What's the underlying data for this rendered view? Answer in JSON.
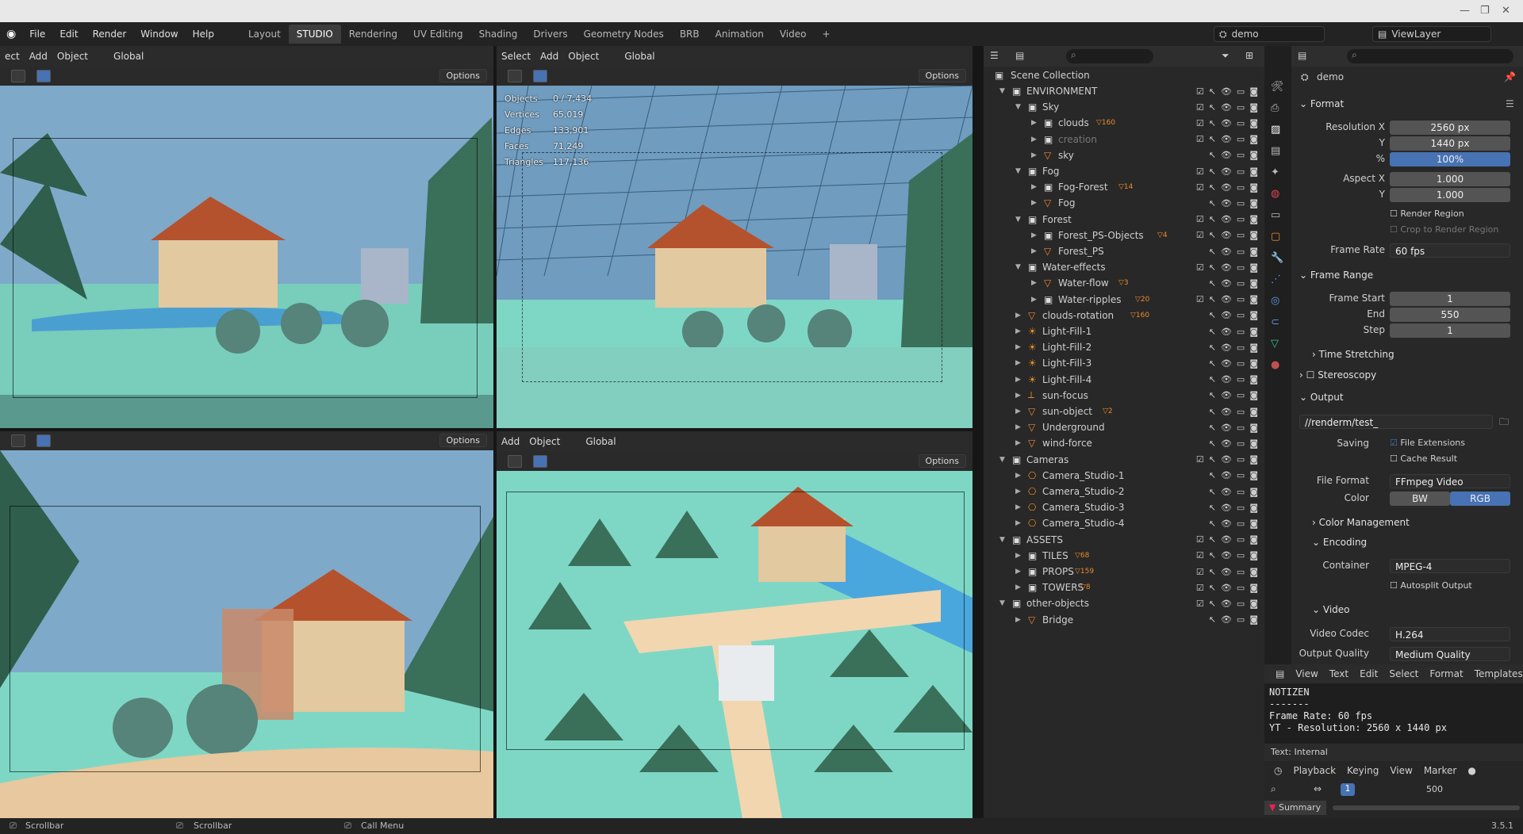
{
  "topbar": {
    "menus": [
      "File",
      "Edit",
      "Render",
      "Window",
      "Help"
    ],
    "workspaces": [
      "Layout",
      "STUDIO",
      "Rendering",
      "UV Editing",
      "Shading",
      "Drivers",
      "Geometry Nodes",
      "BRB",
      "Animation",
      "Video"
    ],
    "active_workspace": "STUDIO",
    "plus": "+",
    "scene_name": "demo",
    "view_layer": "ViewLayer"
  },
  "viewports": {
    "tl": {
      "header": [
        "ect",
        "Add",
        "Object",
        "Global"
      ],
      "options": "Options"
    },
    "tr": {
      "header": [
        "Select",
        "Add",
        "Object",
        "Global"
      ],
      "options": "Options",
      "stats": [
        [
          "Objects",
          "0 / 7,434"
        ],
        [
          "Vertices",
          "65,019"
        ],
        [
          "Edges",
          "133,901"
        ],
        [
          "Faces",
          "71,249"
        ],
        [
          "Triangles",
          "117,136"
        ]
      ]
    },
    "bl": {
      "header": [],
      "options": "Options"
    },
    "br": {
      "header": [
        "Add",
        "Object",
        "Global"
      ],
      "options": "Options"
    }
  },
  "outliner": {
    "root": "Scene Collection",
    "rows": [
      {
        "name": "ENVIRONMENT",
        "indent": 0,
        "type": "collection",
        "expanded": true
      },
      {
        "name": "Sky",
        "indent": 1,
        "type": "collection",
        "expanded": true
      },
      {
        "name": "clouds",
        "indent": 2,
        "type": "collection",
        "badge": "160"
      },
      {
        "name": "creation",
        "indent": 2,
        "type": "collection",
        "dim": true
      },
      {
        "name": "sky",
        "indent": 2,
        "type": "mesh"
      },
      {
        "name": "Fog",
        "indent": 1,
        "type": "collection",
        "expanded": true
      },
      {
        "name": "Fog-Forest",
        "indent": 2,
        "type": "collection",
        "badge": "14"
      },
      {
        "name": "Fog",
        "indent": 2,
        "type": "mesh"
      },
      {
        "name": "Forest",
        "indent": 1,
        "type": "collection",
        "expanded": true
      },
      {
        "name": "Forest_PS-Objects",
        "indent": 2,
        "type": "collection",
        "badge": "4"
      },
      {
        "name": "Forest_PS",
        "indent": 2,
        "type": "mesh"
      },
      {
        "name": "Water-effects",
        "indent": 1,
        "type": "collection",
        "expanded": true
      },
      {
        "name": "Water-flow",
        "indent": 2,
        "type": "mesh",
        "badge": "3"
      },
      {
        "name": "Water-ripples",
        "indent": 2,
        "type": "collection",
        "badge": "20"
      },
      {
        "name": "clouds-rotation",
        "indent": 1,
        "type": "mesh",
        "badge": "160"
      },
      {
        "name": "Light-Fill-1",
        "indent": 1,
        "type": "light"
      },
      {
        "name": "Light-Fill-2",
        "indent": 1,
        "type": "light"
      },
      {
        "name": "Light-Fill-3",
        "indent": 1,
        "type": "light"
      },
      {
        "name": "Light-Fill-4",
        "indent": 1,
        "type": "light"
      },
      {
        "name": "sun-focus",
        "indent": 1,
        "type": "empty"
      },
      {
        "name": "sun-object",
        "indent": 1,
        "type": "mesh",
        "badge": "2"
      },
      {
        "name": "Underground",
        "indent": 1,
        "type": "mesh"
      },
      {
        "name": "wind-force",
        "indent": 1,
        "type": "mesh"
      },
      {
        "name": "Cameras",
        "indent": 0,
        "type": "collection",
        "expanded": true
      },
      {
        "name": "Camera_Studio-1",
        "indent": 1,
        "type": "camera"
      },
      {
        "name": "Camera_Studio-2",
        "indent": 1,
        "type": "camera"
      },
      {
        "name": "Camera_Studio-3",
        "indent": 1,
        "type": "camera"
      },
      {
        "name": "Camera_Studio-4",
        "indent": 1,
        "type": "camera"
      },
      {
        "name": "ASSETS",
        "indent": 0,
        "type": "collection",
        "expanded": true
      },
      {
        "name": "TILES",
        "indent": 1,
        "type": "collection",
        "badge": "68"
      },
      {
        "name": "PROPS",
        "indent": 1,
        "type": "collection",
        "badge": "159"
      },
      {
        "name": "TOWERS",
        "indent": 1,
        "type": "collection",
        "badge": "8"
      },
      {
        "name": "other-objects",
        "indent": 0,
        "type": "collection",
        "expanded": true
      },
      {
        "name": "Bridge",
        "indent": 1,
        "type": "mesh"
      }
    ]
  },
  "props": {
    "object": "demo",
    "format": "Format",
    "res_x_label": "Resolution X",
    "res_x": "2560 px",
    "y_label": "Y",
    "res_y": "1440 px",
    "pct_label": "%",
    "pct": "100%",
    "aspect_label": "Aspect X",
    "aspect_x": "1.000",
    "aspect_y": "1.000",
    "render_region": "Render Region",
    "crop": "Crop to Render Region",
    "frame_rate_label": "Frame Rate",
    "frame_rate": "60 fps",
    "frame_range": "Frame Range",
    "start_label": "Frame Start",
    "start": "1",
    "end_label": "End",
    "end": "550",
    "step_label": "Step",
    "step": "1",
    "time_stretching": "Time Stretching",
    "stereoscopy": "Stereoscopy",
    "output": "Output",
    "path": "//renderm/test_",
    "saving_label": "Saving",
    "file_ext": "File Extensions",
    "cache": "Cache Result",
    "file_format_label": "File Format",
    "file_format": "FFmpeg Video",
    "color_label": "Color",
    "bw": "BW",
    "rgb": "RGB",
    "color_mgmt": "Color Management",
    "encoding": "Encoding",
    "container_label": "Container",
    "container": "MPEG-4",
    "autosplit": "Autosplit Output",
    "video": "Video",
    "codec_label": "Video Codec",
    "codec": "H.264",
    "quality_label": "Output Quality",
    "quality": "Medium Quality"
  },
  "text_editor": {
    "menus": [
      "View",
      "Text",
      "Edit",
      "Select",
      "Format",
      "Templates"
    ],
    "lines": [
      "NOTIZEN",
      "-------",
      "Frame Rate: 60 fps",
      "YT - Resolution: 2560 x 1440 px"
    ],
    "footer": "Text: Internal"
  },
  "timeline": {
    "menus": [
      "Playback",
      "Keying",
      "View",
      "Marker"
    ],
    "current": "1",
    "mark": "500",
    "summary": "Summary"
  },
  "status": {
    "items": [
      "Scrollbar",
      "Scrollbar",
      "Call Menu"
    ],
    "version": "3.5.1"
  },
  "colors": {
    "accent": "#4772b3",
    "sky": "#7ea9c9",
    "ground": "#7ed7c5",
    "roof": "#b5522e",
    "tree": "#3a6f5a"
  }
}
